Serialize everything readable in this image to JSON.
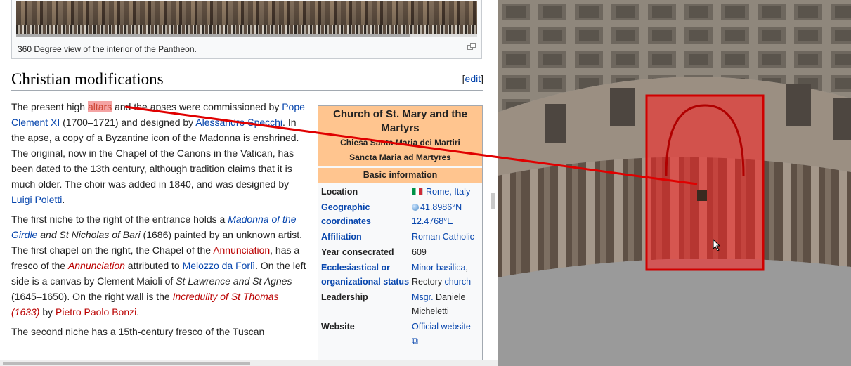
{
  "thumbnail": {
    "caption": "360 Degree view of the interior of the Pantheon.",
    "enlarge_icon": "magnify-icon"
  },
  "section": {
    "title": "Christian modifications",
    "edit_open": "[",
    "edit_label": "edit",
    "edit_close": "]"
  },
  "paragraphs": {
    "p1": {
      "t1": "The present high ",
      "highlight": "altars",
      "t2": " and the apses were commissioned by ",
      "link_pope": "Pope Clement XI",
      "t3": " (1700–1721) and designed by ",
      "link_specchi": "Alessandro Specchi",
      "t4": ". In the apse, a copy of a Byzantine icon of the Madonna is enshrined. The original, now in the Chapel of the Canons in the Vatican, has been dated to the 13th century, although tradition claims that it is much older. The choir was added in 1840, and was designed by ",
      "link_poletti": "Luigi Poletti",
      "t5": "."
    },
    "p2": {
      "t1": "The first niche to the right of the entrance holds a ",
      "link_madonna": "Madonna of the Girdle",
      "t2": " and St Nicholas of Bari",
      "t3": " (1686) painted by an unknown artist. The first chapel on the right, the Chapel of the ",
      "link_annunciation": "Annunciation",
      "t4": ", has a fresco of the ",
      "link_annunciation2": "Annunciation",
      "t5": " attributed to ",
      "link_melozzo": "Melozzo da Forlì",
      "t6": ". On the left side is a canvas by Clement Maioli of ",
      "t7": "St Lawrence and St Agnes",
      "t8": " (1645–1650). On the right wall is the ",
      "link_incredulity": "Incredulity of St Thomas (1633)",
      "t9": " by ",
      "link_bonzi": "Pietro Paolo Bonzi",
      "t10": "."
    },
    "p3": {
      "t1": "The second niche has a 15th-century fresco of the Tuscan"
    }
  },
  "infobox": {
    "title": "Church of St. Mary and the Martyrs",
    "subtitle1": "Chiesa Santa Maria dei Martiri",
    "subtitle2": "Sancta Maria ad Martyres",
    "section": "Basic information",
    "rows": [
      {
        "label": "Location",
        "value": "Rome, Italy"
      },
      {
        "label": "Geographic coordinates",
        "value": "41.8986°N 12.4768°E"
      },
      {
        "label": "Affiliation",
        "value": "Roman Catholic"
      },
      {
        "label": "Year consecrated",
        "value": "609"
      },
      {
        "label": "Ecclesiastical or organizational status",
        "value_link": "Minor basilica",
        "value_sep": ", Rectory ",
        "value_link2": "church"
      },
      {
        "label": "Leadership",
        "value_link": "Msgr.",
        "value_rest": " Daniele Micheletti"
      },
      {
        "label": "Website",
        "value_link": "Official website"
      }
    ]
  },
  "colors": {
    "link": "#0645ad",
    "redlink": "#ba0000",
    "infobox_header": "#ffc58f",
    "highlight_box": "#ff3030",
    "connector_line": "#e00000"
  }
}
